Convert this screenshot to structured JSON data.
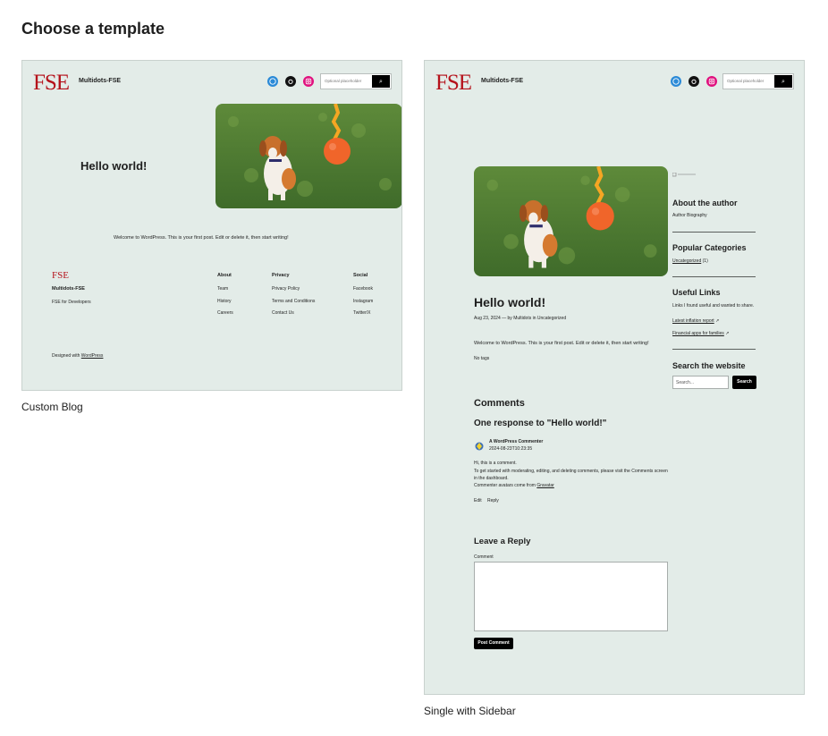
{
  "page": {
    "title": "Choose a template"
  },
  "templates": [
    {
      "caption": "Custom Blog",
      "header": {
        "logo": "FSE",
        "site_name": "Multidots-FSE",
        "search_placeholder": "Optional placeholder",
        "search_button": "⌕"
      },
      "post_title": "Hello world!",
      "excerpt": "Welcome to WordPress. This is your first post. Edit or delete it, then start writing!",
      "footer": {
        "logo": "FSE",
        "site_name": "Multidots-FSE",
        "tagline": "FSE for Developers",
        "columns": [
          {
            "title": "About",
            "links": [
              "Team",
              "History",
              "Careers"
            ]
          },
          {
            "title": "Privacy",
            "links": [
              "Privacy Policy",
              "Terms and Conditions",
              "Contact Us"
            ]
          },
          {
            "title": "Social",
            "links": [
              "Facebook",
              "Instagram",
              "Twitter/X"
            ]
          }
        ],
        "credit_prefix": "Designed with",
        "credit_link": "WordPress"
      }
    },
    {
      "caption": "Single with Sidebar",
      "header": {
        "logo": "FSE",
        "site_name": "Multidots-FSE",
        "search_placeholder": "Optional placeholder",
        "search_button": "⌕"
      },
      "post_title": "Hello world!",
      "post_meta": "Aug 23, 2024 — by Multidots in Uncategorized",
      "content": "Welcome to WordPress. This is your first post. Edit or delete it, then start writing!",
      "tags": "No tags",
      "comments": {
        "heading": "Comments",
        "count_heading": "One response to \"Hello world!\"",
        "author": "A WordPress Commenter",
        "date": "2024-08-23T10:23:35",
        "lines": [
          "Hi, this is a comment.",
          "To get started with moderating, editing, and deleting comments, please visit the Comments screen",
          "in the dashboard."
        ],
        "gravatar_prefix": "Commenter avatars come from",
        "gravatar_link": "Gravatar",
        "edit": "Edit",
        "reply": "Reply"
      },
      "reply_form": {
        "heading": "Leave a Reply",
        "label": "Comment",
        "submit": "Post Comment"
      },
      "sidebar": {
        "about_heading": "About the author",
        "about_text": "Author Biography",
        "categories_heading": "Popular Categories",
        "category": "Uncategorized",
        "category_count": "(1)",
        "links_heading": "Useful Links",
        "links_intro": "Links I found useful and wanted to share.",
        "link1": "Latest inflation report",
        "link2": "Financial apps for families",
        "search_heading": "Search the website",
        "search_placeholder": "Search...",
        "search_button": "Search"
      }
    }
  ],
  "colors": {
    "canvas": "#e3ece8",
    "logo_red": "#b5121b",
    "wordpress_blue": "#2b8ad7",
    "instagram_pink": "#e0117e"
  },
  "icons": [
    "wordpress-icon",
    "github-icon",
    "instagram-icon",
    "search-icon",
    "external-link-icon",
    "avatar-icon"
  ]
}
